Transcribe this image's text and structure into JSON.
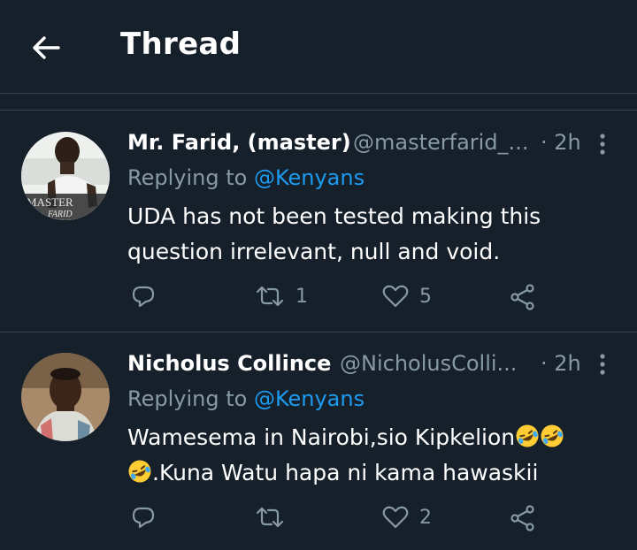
{
  "header": {
    "title": "Thread",
    "back_icon": "arrow-left-icon"
  },
  "colors": {
    "background": "#15202b",
    "divider": "#38444d",
    "secondary": "#8899a6",
    "accent": "#1d9bf0"
  },
  "tweets": [
    {
      "name": "Mr. Farid, (master)",
      "handle": "@masterfarid_...",
      "time": "· 2h",
      "replying_prefix": "Replying to ",
      "replying_handle": "@Kenyans",
      "text": "UDA has not been tested making this question irrelevant, null and void.",
      "avatar_text": "MASTER FARID",
      "reply_count": "",
      "retweet_count": "1",
      "like_count": "5"
    },
    {
      "name": "Nicholus Collince",
      "handle": "@NicholusColli...",
      "time": "· 2h",
      "replying_prefix": "Replying to ",
      "replying_handle": "@Kenyans",
      "text_part1": "Wamesema in Nairobi,sio Kipkelion",
      "text_part2": ".Kuna Watu hapa ni kama hawaskii",
      "reply_count": "",
      "retweet_count": "",
      "like_count": "2"
    }
  ]
}
